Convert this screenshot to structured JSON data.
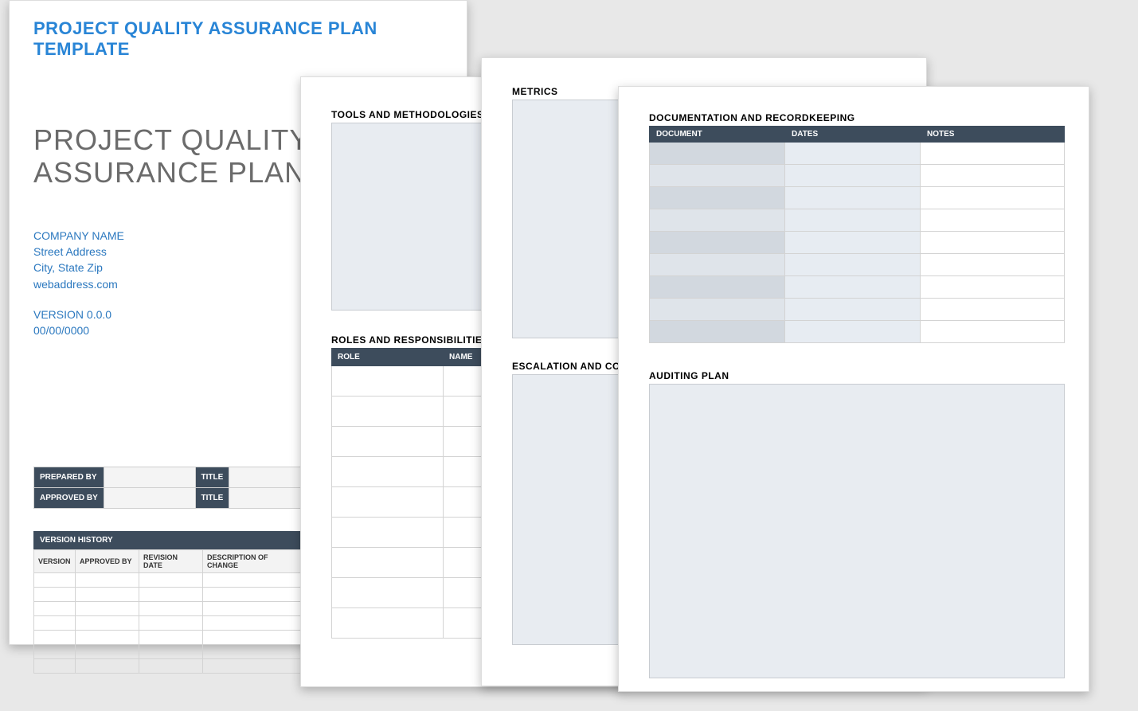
{
  "page1": {
    "template_title": "PROJECT QUALITY ASSURANCE PLAN TEMPLATE",
    "doc_title_line1": "PROJECT QUALITY",
    "doc_title_line2": "ASSURANCE PLAN",
    "company": {
      "name": "COMPANY NAME",
      "street": "Street Address",
      "city": "City, State Zip",
      "web": "webaddress.com"
    },
    "version_label": "VERSION 0.0.0",
    "date": "00/00/0000",
    "sign": {
      "prepared_by_label": "PREPARED BY",
      "approved_by_label": "APPROVED BY",
      "title_label": "TITLE"
    },
    "history": {
      "heading": "VERSION HISTORY",
      "cols": [
        "VERSION",
        "APPROVED BY",
        "REVISION DATE",
        "DESCRIPTION OF CHANGE"
      ],
      "row_count": 7
    }
  },
  "page2": {
    "tools_heading": "TOOLS AND METHODOLOGIES",
    "roles_heading": "ROLES AND RESPONSIBILITIES",
    "roles_cols": [
      "ROLE",
      "NAME"
    ],
    "roles_row_count": 9
  },
  "page3": {
    "metrics_heading": "METRICS",
    "escalation_heading": "ESCALATION AND CORRE"
  },
  "page4": {
    "doc_heading": "DOCUMENTATION AND RECORDKEEPING",
    "doc_cols": [
      "DOCUMENT",
      "DATES",
      "NOTES"
    ],
    "doc_row_count": 9,
    "audit_heading": "AUDITING PLAN"
  }
}
